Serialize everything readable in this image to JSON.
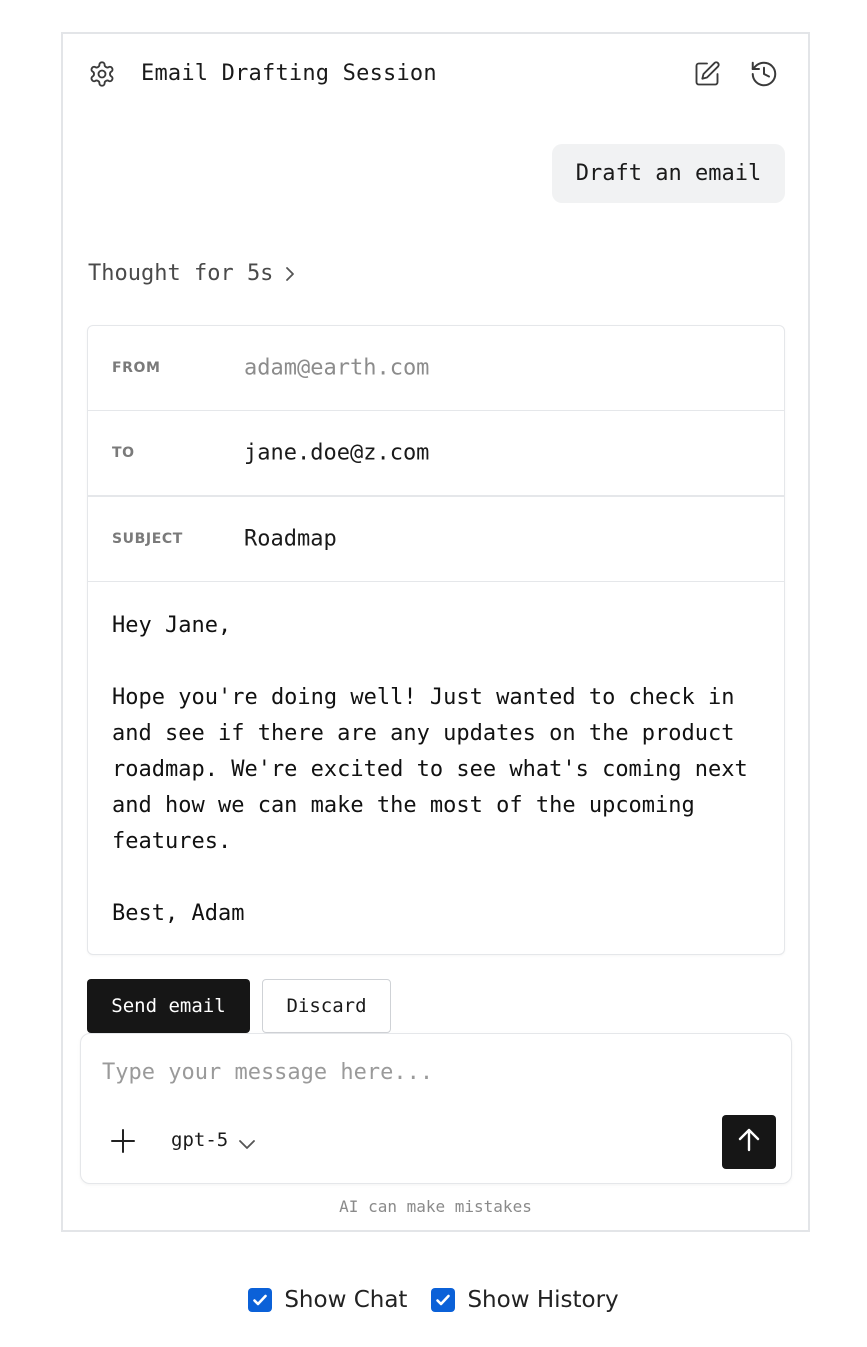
{
  "header": {
    "title": "Email Drafting Session",
    "settings_icon": "gear-icon",
    "edit_icon": "edit-icon",
    "history_icon": "history-icon"
  },
  "chat": {
    "user_message": "Draft an email",
    "thought_label": "Thought for 5s"
  },
  "email": {
    "from_label": "FROM",
    "from_value": "adam@earth.com",
    "to_label": "TO",
    "to_value": "jane.doe@z.com",
    "subject_label": "SUBJECT",
    "subject_value": "Roadmap",
    "body": "Hey Jane,\n\nHope you're doing well! Just wanted to check in and see if there are any updates on the product roadmap. We're excited to see what's coming next and how we can make the most of the upcoming features.\n\nBest, Adam"
  },
  "actions": {
    "send_label": "Send email",
    "discard_label": "Discard"
  },
  "composer": {
    "placeholder": "Type your message here...",
    "model": "gpt-5",
    "disclaimer": "AI can make mistakes"
  },
  "toggles": {
    "show_chat_label": "Show Chat",
    "show_chat_checked": true,
    "show_history_label": "Show History",
    "show_history_checked": true
  },
  "colors": {
    "accent_dark": "#161616",
    "checkbox_blue": "#0b61d8",
    "border": "#e3e5e8"
  }
}
